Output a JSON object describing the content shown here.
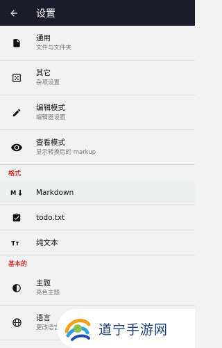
{
  "app_bar": {
    "title": "设置",
    "back_icon": "arrow-left-icon"
  },
  "groups": [
    {
      "label": "通用",
      "sub": "文件与文件夹",
      "icon": "file-icon"
    },
    {
      "label": "其它",
      "sub": "杂项设置",
      "icon": "grid-icon"
    },
    {
      "label": "编辑模式",
      "sub": "编辑器设置",
      "icon": "pencil-icon"
    },
    {
      "label": "查看模式",
      "sub": "显示转换后的 markup",
      "icon": "eye-icon"
    }
  ],
  "section_format": "格式",
  "formats": [
    {
      "label": "Markdown",
      "icon": "markdown-icon"
    },
    {
      "label": "todo.txt",
      "icon": "checklist-icon"
    },
    {
      "label": "纯文本",
      "icon": "text-icon"
    }
  ],
  "section_basic": "基本的",
  "basic": [
    {
      "label": "主题",
      "sub": "亮色主题",
      "icon": "theme-icon"
    },
    {
      "label": "语言",
      "sub": "更改语言",
      "icon": "globe-icon"
    }
  ],
  "watermark": {
    "text": "道宁手游网"
  },
  "colors": {
    "appbar": "#1c1b2b",
    "section": "#d23b3b",
    "background": "#f2f2f2"
  }
}
